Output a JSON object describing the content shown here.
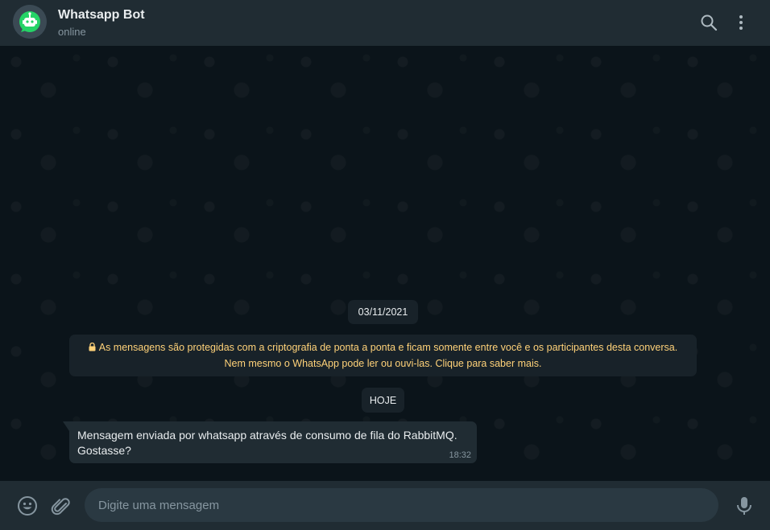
{
  "header": {
    "title": "Whatsapp Bot",
    "status": "online",
    "avatar_icon": "robot-icon",
    "search_icon": "search-icon",
    "menu_icon": "kebab-menu-icon"
  },
  "chat": {
    "date_label": "03/11/2021",
    "encryption_notice": {
      "line1": "As mensagens são protegidas com a criptografia de ponta a ponta e ficam somente entre você e os participantes desta conversa.",
      "line2": "Nem mesmo o WhatsApp pode ler ou ouvi-las. Clique para saber mais."
    },
    "today_label": "HOJE",
    "messages": [
      {
        "line1": "Mensagem enviada por whatsapp através de consumo de fila do RabbitMQ.",
        "line2": "Gostasse?",
        "time": "18:32",
        "direction": "incoming"
      }
    ]
  },
  "footer": {
    "input_placeholder": "Digite uma mensagem",
    "input_value": "",
    "emoji_icon": "emoji-icon",
    "attach_icon": "paperclip-icon",
    "mic_icon": "microphone-icon"
  },
  "colors": {
    "header_bg": "#202c33",
    "chat_bg": "#0b141a",
    "bubble_bg": "#202c33",
    "notice_text": "#ffd279",
    "primary_text": "#e9edef",
    "secondary_text": "#8696a0",
    "avatar_accent": "#25d366"
  }
}
